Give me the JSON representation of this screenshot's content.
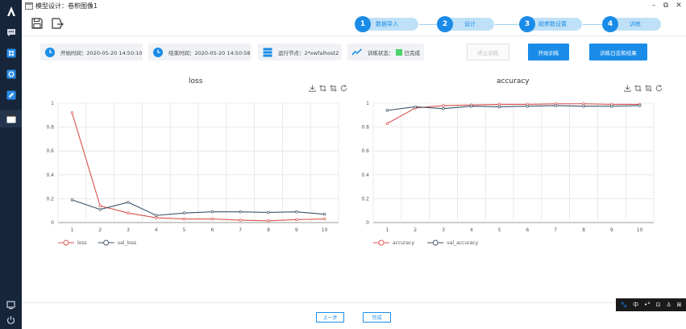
{
  "window": {
    "title": "模型设计：卷积图像1",
    "minimize": "–",
    "restore": "⧉",
    "close": "✕"
  },
  "steps": [
    {
      "num": "1",
      "label": "数据导入"
    },
    {
      "num": "2",
      "label": "设计"
    },
    {
      "num": "3",
      "label": "超参数设置"
    },
    {
      "num": "4",
      "label": "训练"
    }
  ],
  "info": {
    "start_time": "开始时间：2020-05-20 14:50:10",
    "end_time": "结束时间：2020-05-20 14:50:58",
    "node": "运行节点：2*xwfalhost2",
    "status_prefix": "训练状态：",
    "status_value": "已完成",
    "status_color": "#4cd26a"
  },
  "buttons": {
    "stop": "终止训练",
    "start": "开始训练",
    "log": "训练日志和结果",
    "prev": "上一步",
    "done": "完成"
  },
  "colors": {
    "accent": "#1a8ce8",
    "series_primary": "#d9534f",
    "series_secondary": "#3d5269"
  },
  "tray": [
    "🐾",
    "中",
    "•°",
    "⊡",
    "♙",
    "⊞"
  ],
  "chart_data": [
    {
      "type": "line",
      "title": "loss",
      "x": [
        1,
        2,
        3,
        4,
        5,
        6,
        7,
        8,
        9,
        10
      ],
      "ylim": [
        0,
        1
      ],
      "yticks": [
        "0",
        "0.2",
        "0.4",
        "0.6",
        "0.8",
        "1"
      ],
      "grid": true,
      "legend": "bottom-left",
      "series": [
        {
          "name": "loss",
          "values": [
            0.92,
            0.14,
            0.08,
            0.04,
            0.03,
            0.03,
            0.02,
            0.015,
            0.025,
            0.03
          ]
        },
        {
          "name": "val_loss",
          "values": [
            0.19,
            0.11,
            0.17,
            0.06,
            0.08,
            0.09,
            0.09,
            0.085,
            0.09,
            0.07
          ]
        }
      ]
    },
    {
      "type": "line",
      "title": "accuracy",
      "x": [
        1,
        2,
        3,
        4,
        5,
        6,
        7,
        8,
        9,
        10
      ],
      "ylim": [
        0,
        1
      ],
      "yticks": [
        "0",
        "0.2",
        "0.4",
        "0.6",
        "0.8",
        "1"
      ],
      "grid": true,
      "legend": "bottom-left",
      "series": [
        {
          "name": "accuracy",
          "values": [
            0.83,
            0.96,
            0.98,
            0.985,
            0.99,
            0.99,
            0.995,
            0.995,
            0.99,
            0.99
          ]
        },
        {
          "name": "val_accuracy",
          "values": [
            0.94,
            0.97,
            0.955,
            0.975,
            0.97,
            0.975,
            0.98,
            0.975,
            0.975,
            0.98
          ]
        }
      ]
    }
  ]
}
